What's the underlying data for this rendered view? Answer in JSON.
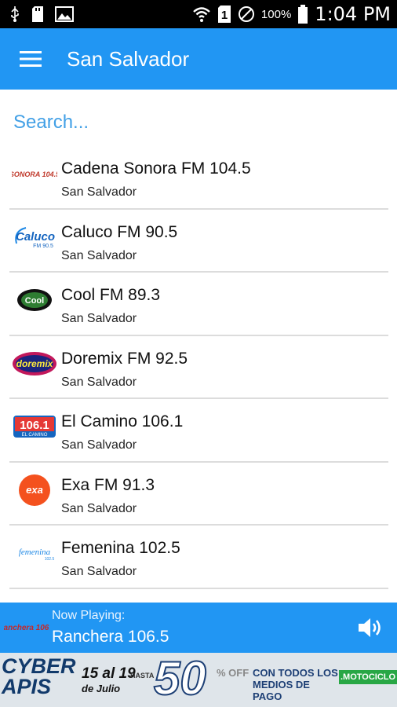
{
  "status_bar": {
    "battery_percent": "100%",
    "time": "1:04 PM",
    "sim_slot": "1"
  },
  "app_bar": {
    "title": "San Salvador",
    "menu_icon": "hamburger-menu-icon"
  },
  "search": {
    "placeholder": "Search..."
  },
  "stations": [
    {
      "name": "Cadena Sonora FM 104.5",
      "city": "San Salvador",
      "logo": "cadena-sonora-logo"
    },
    {
      "name": "Caluco FM 90.5",
      "city": "San Salvador",
      "logo": "caluco-logo"
    },
    {
      "name": "Cool FM 89.3",
      "city": "San Salvador",
      "logo": "cool-fm-logo"
    },
    {
      "name": "Doremix FM 92.5",
      "city": "San Salvador",
      "logo": "doremix-logo"
    },
    {
      "name": "El Camino 106.1",
      "city": "San Salvador",
      "logo": "el-camino-logo"
    },
    {
      "name": "Exa FM 91.3",
      "city": "San Salvador",
      "logo": "exa-fm-logo"
    },
    {
      "name": "Femenina 102.5",
      "city": "San Salvador",
      "logo": "femenina-logo"
    }
  ],
  "now_playing": {
    "label": "Now Playing:",
    "station": "Ranchera 106.5",
    "volume_icon": "volume-icon"
  },
  "ad_banner": {
    "brand_line1": "CYBER",
    "brand_line2": "APIS",
    "dates": "15 al 19",
    "month": "de Julio",
    "hasta": "HASTA",
    "discount": "50",
    "off": "% OFF",
    "payment": "CON TODOS LOS MEDIOS DE PAGO",
    "partner": ".MOTOCICLO"
  },
  "colors": {
    "primary": "#2196f3",
    "status_bar": "#000000",
    "divider": "#dcdcdc"
  }
}
